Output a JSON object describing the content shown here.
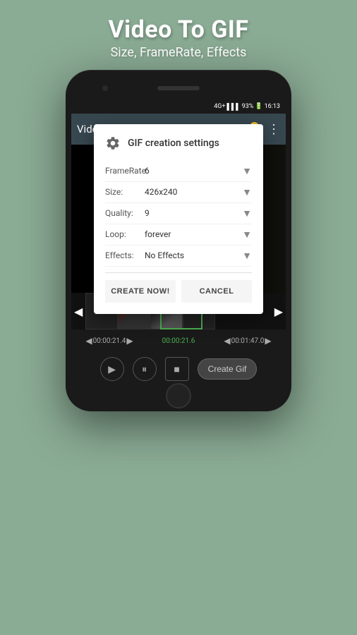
{
  "header": {
    "title": "Video To GIF",
    "subtitle": "Size, FrameRate, Effects"
  },
  "status_bar": {
    "network": "4G+",
    "battery": "93%",
    "time": "16:13"
  },
  "toolbar": {
    "title": "Video To GIF",
    "icons": [
      "add-icon",
      "check-icon",
      "key-icon",
      "more-icon"
    ]
  },
  "dialog": {
    "title": "GIF creation settings",
    "rows": [
      {
        "label": "FrameRate:",
        "value": "6"
      },
      {
        "label": "Size:",
        "value": "426x240"
      },
      {
        "label": "Quality:",
        "value": "9"
      },
      {
        "label": "Loop:",
        "value": "forever"
      },
      {
        "label": "Effects:",
        "value": "No Effects"
      }
    ],
    "btn_create": "CREATE NOW!",
    "btn_cancel": "CANCEL"
  },
  "timecodes": {
    "start": "00:00:21.4",
    "current": "00:00:21.6",
    "end": "00:01:47.0"
  },
  "controls": {
    "play_label": "play",
    "pause_label": "pause",
    "stop_label": "stop",
    "create_gif_label": "Create Gif"
  }
}
